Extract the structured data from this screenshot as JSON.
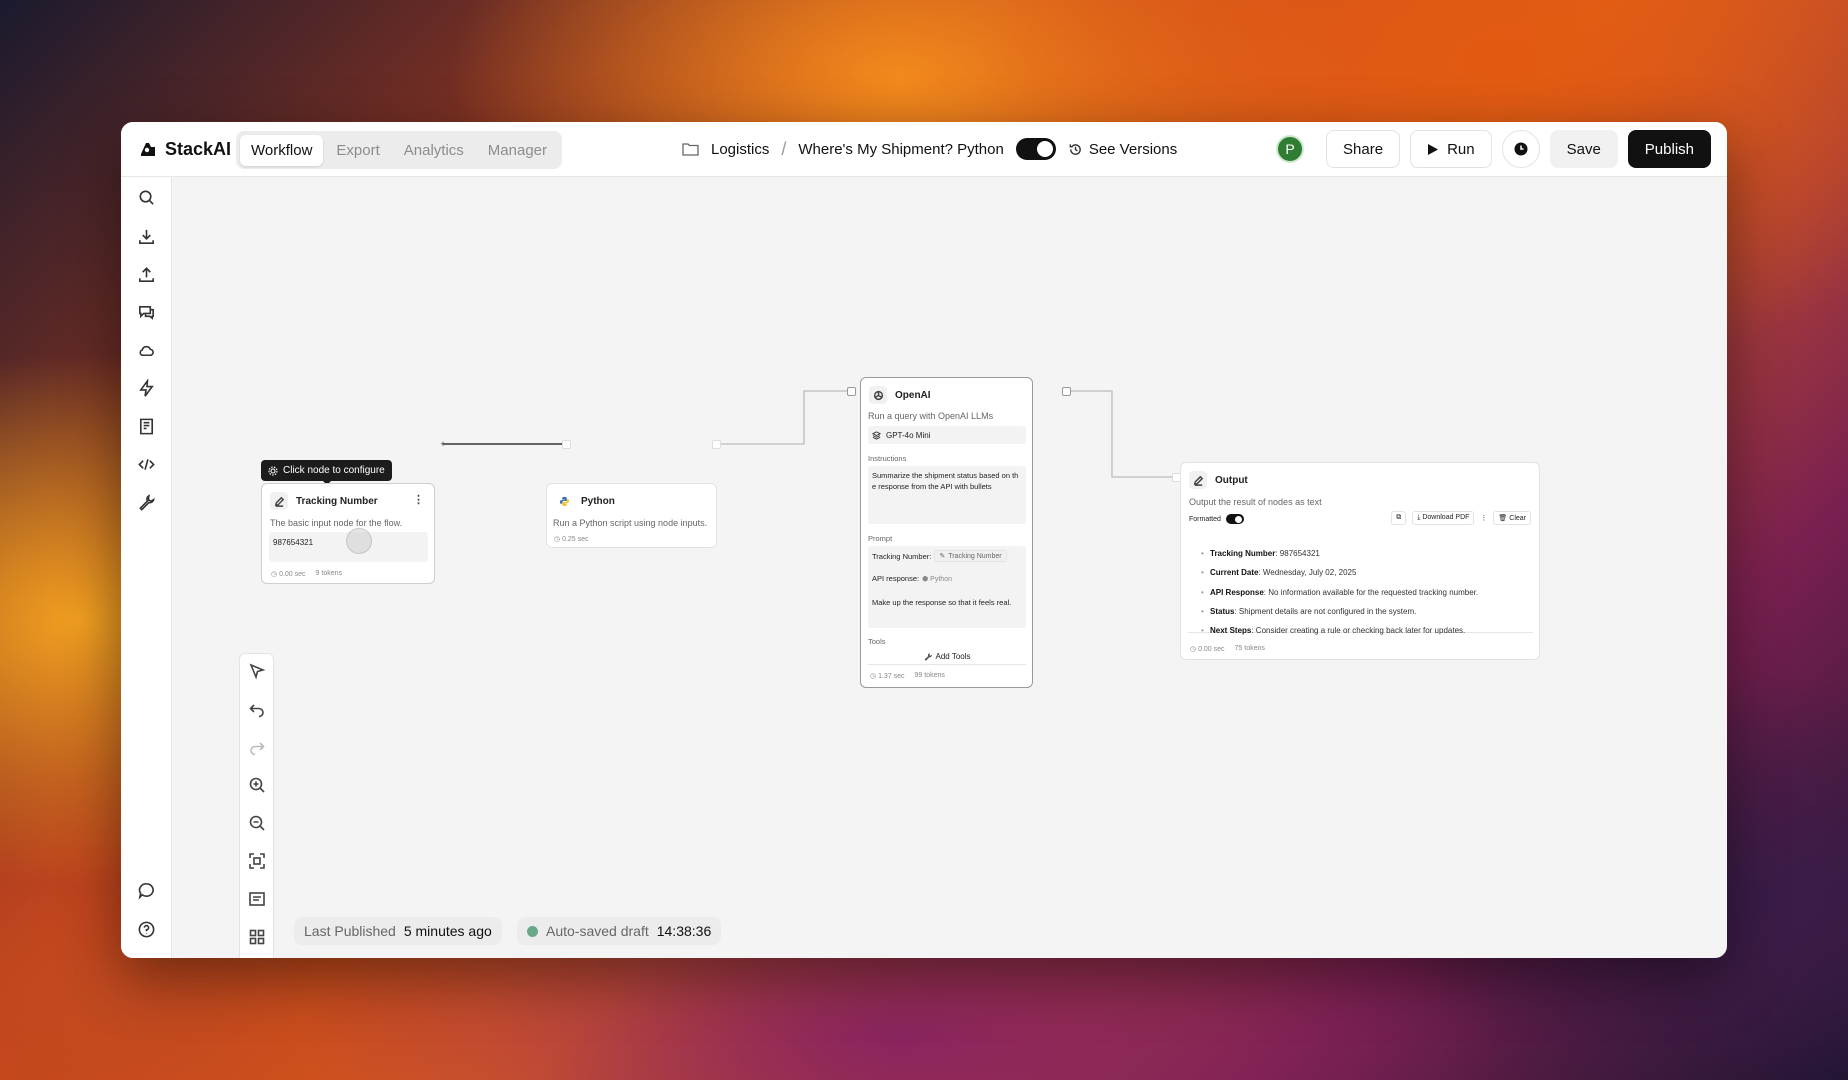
{
  "app": {
    "logo_text": "StackAI",
    "tabs": [
      "Workflow",
      "Export",
      "Analytics",
      "Manager"
    ],
    "active_tab": "Workflow"
  },
  "breadcrumb": {
    "folder": "Logistics",
    "separator": "/",
    "project": "Where's My Shipment? Python",
    "see_versions": "See Versions"
  },
  "toolbar": {
    "avatar_initial": "P",
    "share": "Share",
    "run": "Run",
    "save": "Save",
    "publish": "Publish"
  },
  "tooltip": "Click node to configure",
  "nodes": {
    "tracking": {
      "title": "Tracking Number",
      "desc": "The basic input node for the flow.",
      "value": "987654321",
      "time": "0.00 sec",
      "tokens": "9 tokens"
    },
    "python": {
      "title": "Python",
      "desc": "Run a Python script using node inputs.",
      "time": "0.25 sec"
    },
    "openai": {
      "title": "OpenAI",
      "desc": "Run a query with OpenAI LLMs",
      "model": "GPT-4o Mini",
      "instructions_label": "Instructions",
      "instructions": "Summarize the shipment status based on the response from the API with bullets",
      "prompt_label": "Prompt",
      "prompt_line1_label": "Tracking Number:",
      "prompt_line1_chip": "Tracking Number",
      "prompt_line2_label": "API response:",
      "prompt_line2_chip": "Python",
      "prompt_line3": "Make up the response so that it feels real.",
      "tools_label": "Tools",
      "add_tools": "Add Tools",
      "time": "1.37 sec",
      "tokens": "99 tokens"
    },
    "output": {
      "title": "Output",
      "desc": "Output the result of nodes as text",
      "formatted_label": "Formatted",
      "download_pdf": "Download PDF",
      "clear": "Clear",
      "lines": [
        {
          "label": "Tracking Number",
          "text": ": 987654321"
        },
        {
          "label": "Current Date",
          "text": ": Wednesday, July 02, 2025"
        },
        {
          "label": "API Response",
          "text": ": No information available for the requested tracking number."
        },
        {
          "label": "Status",
          "text": ": Shipment details are not configured in the system."
        },
        {
          "label": "Next Steps",
          "text": ": Consider creating a rule or checking back later for updates."
        }
      ],
      "time": "0.00 sec",
      "tokens": "75 tokens"
    }
  },
  "footer": {
    "published_label": "Last Published",
    "published_value": "5 minutes ago",
    "autosave_label": "Auto-saved draft",
    "autosave_value": "14:38:36"
  },
  "colors": {
    "accent_dark": "#111111",
    "avatar_green": "#2e7d32",
    "autosave_dot": "#6aa88a"
  }
}
